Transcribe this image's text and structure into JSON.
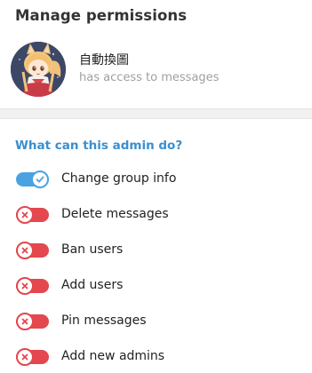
{
  "header": {
    "title": "Manage permissions"
  },
  "user": {
    "name": "自動換圖",
    "status": "has access to messages",
    "avatar_icon": "anime-fox-girl-avatar"
  },
  "permissions": {
    "section_title": "What can this admin do?",
    "items": [
      {
        "label": "Change group info",
        "enabled": true
      },
      {
        "label": "Delete messages",
        "enabled": false
      },
      {
        "label": "Ban users",
        "enabled": false
      },
      {
        "label": "Add users",
        "enabled": false
      },
      {
        "label": "Pin messages",
        "enabled": false
      },
      {
        "label": "Add new admins",
        "enabled": false
      }
    ]
  },
  "colors": {
    "accent": "#3a8fcf",
    "toggle_on": "#4aa3e0",
    "toggle_off": "#e4474e",
    "secondary_text": "#a0a0a0"
  }
}
